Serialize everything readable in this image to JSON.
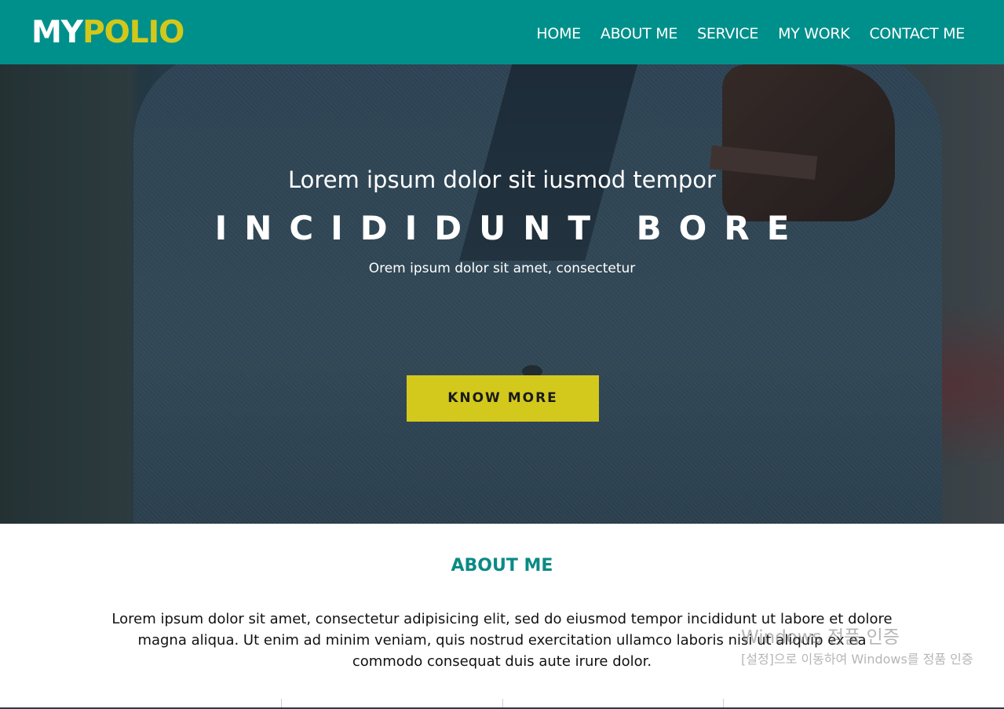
{
  "header": {
    "logo_part1": "MY",
    "logo_part2": "POLIO",
    "nav": [
      "HOME",
      "ABOUT ME",
      "SERVICE",
      "MY WORK",
      "CONTACT ME"
    ]
  },
  "hero": {
    "subtitle": "Lorem ipsum dolor sit iusmod tempor",
    "title": "INCIDIDUNT BORE",
    "description": "Orem ipsum dolor sit amet, consectetur",
    "button_label": "KNOW MORE"
  },
  "about": {
    "title": "ABOUT ME",
    "text": "Lorem ipsum dolor sit amet, consectetur adipisicing elit, sed do eiusmod tempor incididunt ut labore et dolore magna aliqua. Ut enim ad minim veniam, quis nostrud exercitation ullamco laboris nisi ut aliquip ex ea commodo consequat duis aute irure dolor."
  },
  "watermark": {
    "title": "Windows 정품 인증",
    "subtitle": "[설정]으로 이동하여 Windows를 정품 인증"
  },
  "colors": {
    "header_bg": "#00908b",
    "accent_yellow": "#d3c91d",
    "about_title": "#0b8a85"
  }
}
